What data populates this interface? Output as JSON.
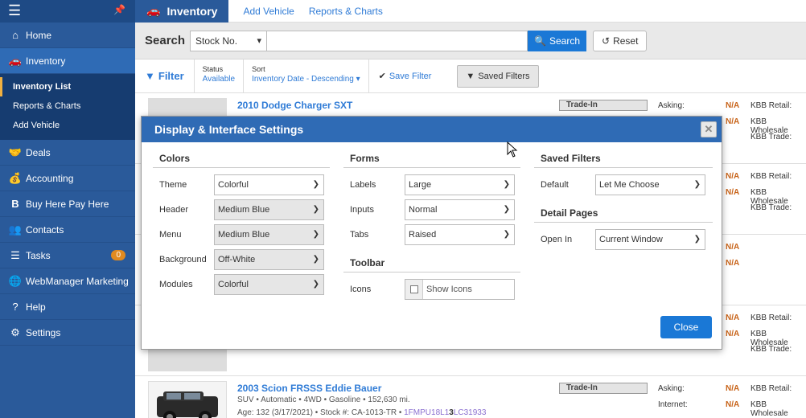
{
  "sidebar": {
    "items": [
      {
        "label": "Home",
        "icon": "home-icon"
      },
      {
        "label": "Inventory",
        "icon": "car-icon"
      },
      {
        "label": "Deals",
        "icon": "handshake-icon"
      },
      {
        "label": "Accounting",
        "icon": "money-bag-icon"
      },
      {
        "label": "Buy Here Pay Here",
        "icon": "b-icon"
      },
      {
        "label": "Contacts",
        "icon": "users-icon"
      },
      {
        "label": "Tasks",
        "icon": "list-icon",
        "badge": "0"
      },
      {
        "label": "WebManager Marketing",
        "icon": "globe-icon"
      },
      {
        "label": "Help",
        "icon": "question-icon"
      },
      {
        "label": "Settings",
        "icon": "gear-icon"
      }
    ],
    "sub": [
      "Inventory List",
      "Reports & Charts",
      "Add Vehicle"
    ]
  },
  "topbar": {
    "title": "Inventory",
    "links": [
      "Add Vehicle",
      "Reports & Charts"
    ]
  },
  "search": {
    "label": "Search",
    "field_select": "Stock No.",
    "button": "Search",
    "reset": "Reset"
  },
  "filterbar": {
    "filter": "Filter",
    "status_title": "Status",
    "status_value": "Available",
    "sort_title": "Sort",
    "sort_value": "Inventory Date - Descending",
    "save_filter": "Save Filter",
    "saved_filters": "Saved Filters"
  },
  "listing": {
    "row1": {
      "title": "2010 Dodge Charger SXT",
      "badge": "Trade-In",
      "asking": "Asking:",
      "na1": "N/A",
      "na2": "N/A",
      "kbb_retail": "KBB Retail:",
      "kbb_wholesale": "KBB Wholesale",
      "kbb_trade": "KBB Trade:"
    },
    "row2": {
      "na1": "N/A",
      "na2": "N/A",
      "kbb_retail": "KBB Retail:",
      "kbb_wholesale": "KBB Wholesale",
      "kbb_trade": "KBB Trade:"
    },
    "row3": {
      "na1": "N/A",
      "na2": "N/A"
    },
    "row4": {
      "na1": "N/A",
      "na2": "N/A",
      "kbb_retail": "KBB Retail:",
      "kbb_wholesale": "KBB Wholesale",
      "kbb_trade": "KBB Trade:"
    },
    "row5": {
      "title": "2003 Scion FRSSS Eddie Bauer",
      "specs": "SUV • Automatic • 4WD • Gasoline • 152,630 mi.",
      "age": "Age: 132 (3/17/2021) • Stock #: CA-1013-TR •",
      "vin_a": "1FMPU18L1",
      "vin_b": "3",
      "vin_c": "LC31933",
      "badge": "Trade-In",
      "asking": "Asking:",
      "internet": "Internet:",
      "na1": "N/A",
      "na2": "N/A",
      "kbb_retail": "KBB Retail:",
      "kbb_wholesale": "KBB Wholesale"
    }
  },
  "modal": {
    "title": "Display & Interface Settings",
    "colors": {
      "title": "Colors",
      "theme_label": "Theme",
      "theme": "Colorful",
      "header_label": "Header",
      "header": "Medium Blue",
      "menu_label": "Menu",
      "menu": "Medium Blue",
      "background_label": "Background",
      "background": "Off-White",
      "modules_label": "Modules",
      "modules": "Colorful"
    },
    "forms": {
      "title": "Forms",
      "labels_label": "Labels",
      "labels": "Large",
      "inputs_label": "Inputs",
      "inputs": "Normal",
      "tabs_label": "Tabs",
      "tabs": "Raised"
    },
    "toolbar": {
      "title": "Toolbar",
      "icons_label": "Icons",
      "show_icons": "Show Icons"
    },
    "saved_filters": {
      "title": "Saved Filters",
      "default_label": "Default",
      "default": "Let Me Choose"
    },
    "detail_pages": {
      "title": "Detail Pages",
      "open_in_label": "Open In",
      "open_in": "Current Window"
    },
    "close_button": "Close"
  }
}
